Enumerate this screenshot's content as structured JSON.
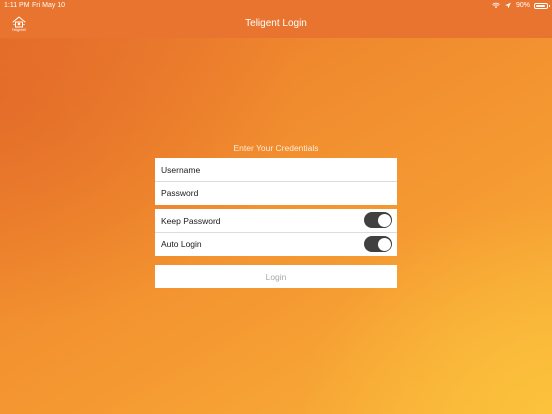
{
  "status_bar": {
    "time": "1:11 PM",
    "date": "Fri May 10",
    "battery": "90%",
    "battery_level": 0.9,
    "icons": [
      "wifi-icon",
      "location-icon",
      "battery-icon"
    ]
  },
  "nav": {
    "title": "Teligent Login",
    "logo_text": "TeligentX",
    "logo_icon": "house-logo-icon"
  },
  "login": {
    "prompt": "Enter Your Credentials",
    "username_placeholder": "Username",
    "password_placeholder": "Password",
    "options": [
      {
        "label": "Keep Password",
        "on": true
      },
      {
        "label": "Auto Login",
        "on": true
      }
    ],
    "button_label": "Login"
  },
  "colors": {
    "nav_bar": "#e8742f",
    "background_start": "#e8702e",
    "background_end": "#f9b43a",
    "toggle_on": "#404040",
    "button_text_disabled": "#a8a8a8"
  }
}
